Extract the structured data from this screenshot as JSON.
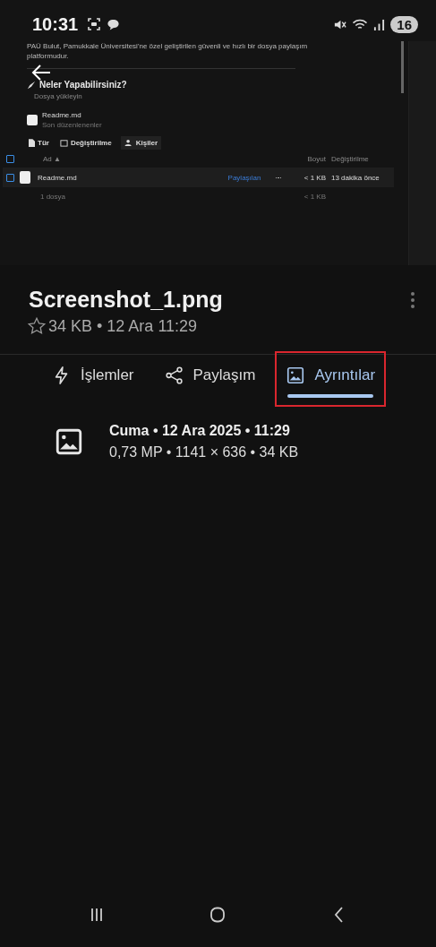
{
  "status_bar": {
    "time": "10:31",
    "battery": "16"
  },
  "preview": {
    "intro": "PAÜ Bulut, Pamukkale Üniversitesi'ne özel geliştirilen güvenli ve hızlı bir dosya paylaşım platformudur.",
    "heading": "Neler Yapabilirsiniz?",
    "bullet": "Dosya yükleyin",
    "recent": {
      "name": "Readme.md",
      "caption": "Son düzenlenenler"
    },
    "filters": [
      {
        "label": "Tür",
        "kind": "type"
      },
      {
        "label": "Değiştirilme",
        "kind": "date"
      },
      {
        "label": "Kişiler",
        "kind": "people"
      }
    ],
    "columns": {
      "name": "Ad ▲",
      "size": "Boyut",
      "modified": "Değiştirilme",
      "all_checked": false
    },
    "rows": [
      {
        "name": "Readme.md",
        "share": "Paylaşılan",
        "size": "< 1 KB",
        "modified": "13 dakika önce",
        "checked": false
      }
    ],
    "footer": {
      "count": "1 dosya",
      "size": "< 1 KB"
    }
  },
  "file": {
    "title": "Screenshot_1.png",
    "starred": false,
    "meta": "34 KB • 12 Ara 11:29"
  },
  "tabs": [
    {
      "label": "İşlemler",
      "kind": "actions",
      "selected": false,
      "highlighted": false
    },
    {
      "label": "Paylaşım",
      "kind": "share",
      "selected": false,
      "highlighted": false
    },
    {
      "label": "Ayrıntılar",
      "kind": "details",
      "selected": true,
      "highlighted": true
    }
  ],
  "details": {
    "date": "Cuma • 12 Ara 2025 • 11:29",
    "info": "0,73 MP • 1141 × 636 • 34 KB"
  }
}
